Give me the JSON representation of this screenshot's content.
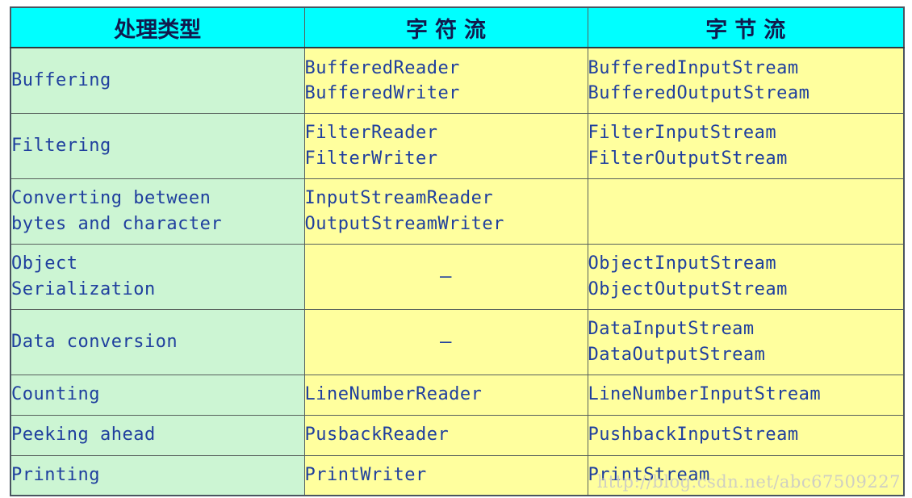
{
  "table": {
    "headers": [
      {
        "text": "处理类型",
        "spaced": false
      },
      {
        "text": "字符流",
        "spaced": true
      },
      {
        "text": "字节流",
        "spaced": true
      }
    ],
    "rows": [
      {
        "category": [
          "Buffering"
        ],
        "character_stream": [
          "BufferedReader",
          "BufferedWriter"
        ],
        "byte_stream": [
          "BufferedInputStream",
          "BufferedOutputStream"
        ]
      },
      {
        "category": [
          "Filtering"
        ],
        "character_stream": [
          "FilterReader",
          "FilterWriter"
        ],
        "byte_stream": [
          "FilterInputStream",
          "FilterOutputStream"
        ]
      },
      {
        "category": [
          "Converting between",
          "bytes and character"
        ],
        "character_stream": [
          "InputStreamReader",
          "OutputStreamWriter"
        ],
        "byte_stream": []
      },
      {
        "category": [
          "Object",
          "Serialization"
        ],
        "character_stream": [
          "—"
        ],
        "byte_stream": [
          "ObjectInputStream",
          "ObjectOutputStream"
        ]
      },
      {
        "category": [
          "Data conversion"
        ],
        "character_stream": [
          "—"
        ],
        "byte_stream": [
          "DataInputStream",
          "DataOutputStream"
        ]
      },
      {
        "category": [
          "Counting"
        ],
        "character_stream": [
          "LineNumberReader"
        ],
        "byte_stream": [
          "LineNumberInputStream"
        ]
      },
      {
        "category": [
          "Peeking ahead"
        ],
        "character_stream": [
          "PusbackReader"
        ],
        "byte_stream": [
          "PushbackInputStream"
        ]
      },
      {
        "category": [
          "Printing"
        ],
        "character_stream": [
          "PrintWriter"
        ],
        "byte_stream": [
          "PrintStream"
        ]
      }
    ]
  },
  "watermark": {
    "text": "http://blog.csdn.net/abc67509227"
  },
  "colors": {
    "header_bg": "#00ffff",
    "category_bg": "#ccf5d3",
    "api_bg": "#ffff9e",
    "text": "#1f3f9e",
    "header_text": "#111a4d",
    "border": "#57605c"
  }
}
